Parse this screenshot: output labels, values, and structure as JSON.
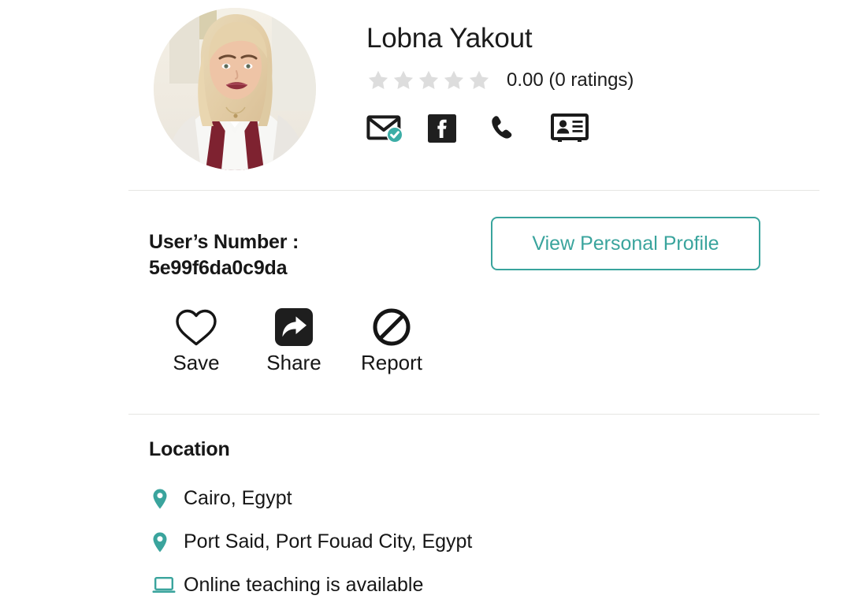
{
  "theme": {
    "accent": "#3AA49D",
    "text": "#161616",
    "star_empty": "#dddddd",
    "divider": "#e6e6e3",
    "icon_dark": "#1e1e1e",
    "background": "#ffffff"
  },
  "profile": {
    "avatar_alt": "profile-photo",
    "name": "Lobna Yakout",
    "rating_value": "0.00",
    "rating_text": "0.00 (0 ratings)",
    "stars_total": 5,
    "stars_filled": 0,
    "contact_icons": [
      {
        "name": "email-icon",
        "label": "Email",
        "verified": true
      },
      {
        "name": "facebook-icon",
        "label": "Facebook",
        "verified": false
      },
      {
        "name": "phone-icon",
        "label": "Phone",
        "verified": false
      },
      {
        "name": "id-card-icon",
        "label": "ID Card",
        "verified": false
      }
    ]
  },
  "details": {
    "user_number_label": "User’s Number :",
    "user_number_value": "5e99f6da0c9da",
    "view_profile_label": "View Personal Profile",
    "actions": [
      {
        "name": "save",
        "label": "Save",
        "icon": "heart-icon"
      },
      {
        "name": "share",
        "label": "Share",
        "icon": "share-icon"
      },
      {
        "name": "report",
        "label": "Report",
        "icon": "ban-icon"
      }
    ]
  },
  "location": {
    "title": "Location",
    "items": [
      {
        "icon": "map-pin-icon",
        "text": "Cairo, Egypt"
      },
      {
        "icon": "map-pin-icon",
        "text": "Port Said, Port Fouad City, Egypt"
      },
      {
        "icon": "laptop-icon",
        "text": "Online teaching is available"
      }
    ]
  }
}
